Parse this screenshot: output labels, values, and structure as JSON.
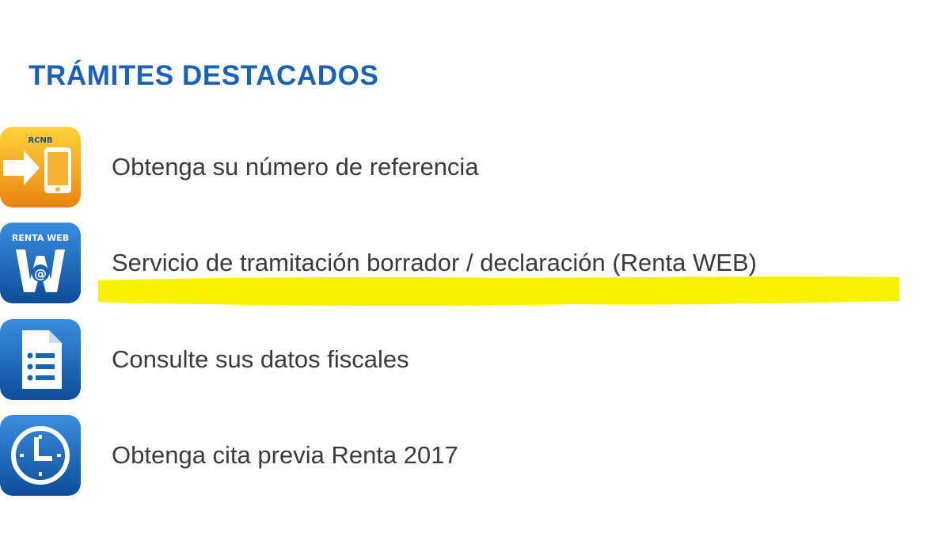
{
  "section": {
    "title": "TRÁMITES DESTACADOS"
  },
  "items": [
    {
      "label": "Obtenga su número de referencia",
      "icon": "rcnb-phone-icon",
      "icon_text": "RCNB",
      "icon_color": "#f0a020"
    },
    {
      "label": "Servicio de tramitación borrador / declaración (Renta WEB)",
      "icon": "renta-web-icon",
      "icon_text": "RENTA WEB",
      "icon_color": "#1763b5"
    },
    {
      "label": "Consulte sus datos fiscales",
      "icon": "document-list-icon",
      "icon_color": "#1763b5"
    },
    {
      "label": "Obtenga cita previa Renta 2017",
      "icon": "clock-icon",
      "icon_color": "#1763b5"
    }
  ],
  "highlight": {
    "color": "#f7f200",
    "target": "Servicio de tramitación borrador / declaración (Renta WEB)"
  },
  "colors": {
    "title": "#1a62b8",
    "text": "#3b3b3b"
  }
}
